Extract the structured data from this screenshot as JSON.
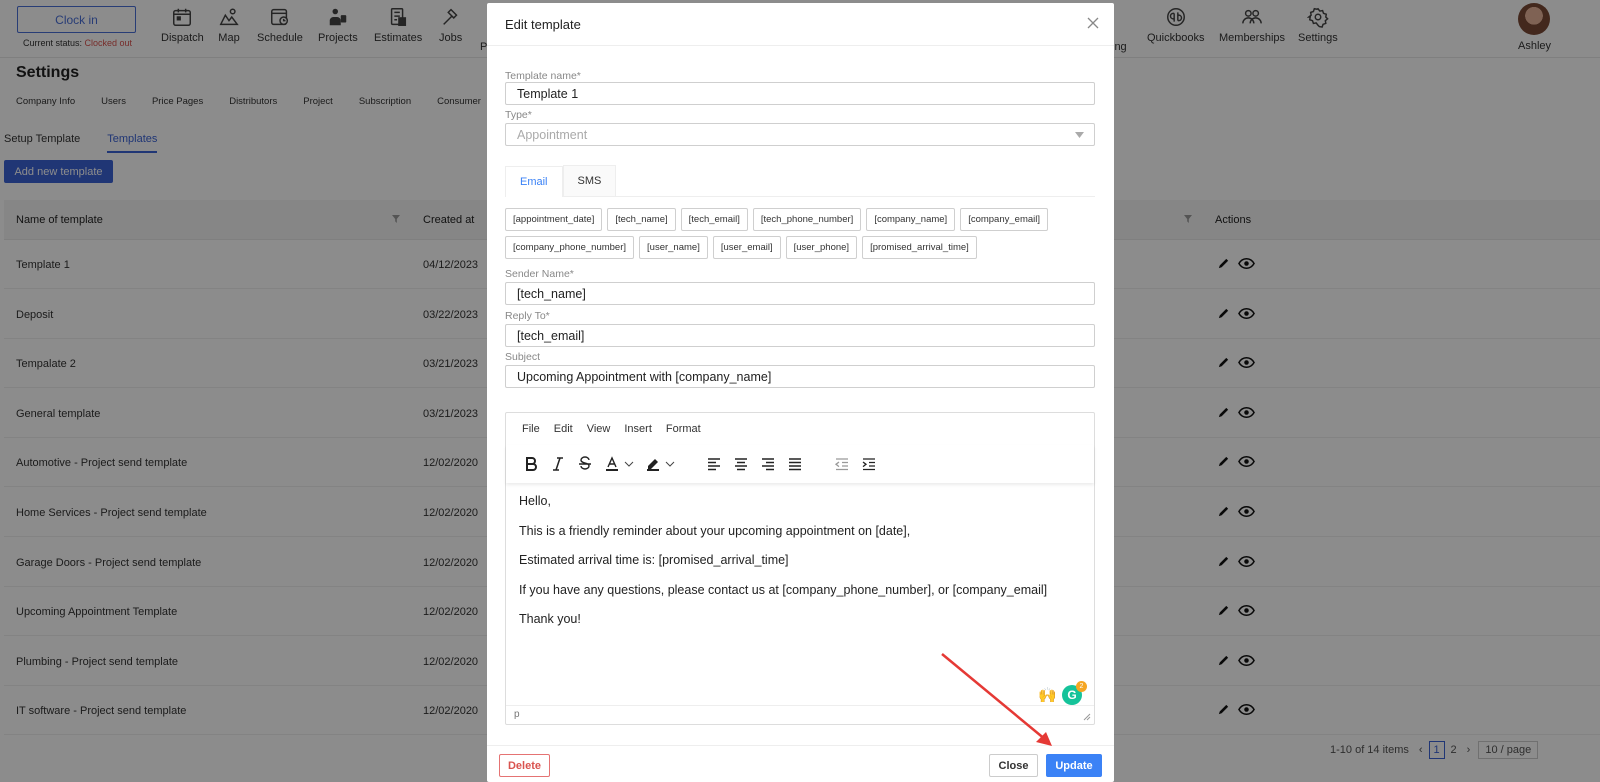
{
  "topbar": {
    "clock_button": "Clock in",
    "status_prefix": "Current status: ",
    "status_value": "Clocked out",
    "nav": [
      {
        "label": "Dispatch",
        "icon": "calendar-icon"
      },
      {
        "label": "Map",
        "icon": "map-icon"
      },
      {
        "label": "Schedule",
        "icon": "schedule-icon"
      },
      {
        "label": "Projects",
        "icon": "projects-icon"
      },
      {
        "label": "Estimates",
        "icon": "estimates-icon"
      },
      {
        "label": "Jobs",
        "icon": "hammer-icon"
      },
      {
        "label": "P",
        "icon": ""
      },
      {
        "label": "ing",
        "icon": ""
      },
      {
        "label": "Quickbooks",
        "icon": "quickbooks-icon"
      },
      {
        "label": "Memberships",
        "icon": "people-icon"
      },
      {
        "label": "Settings",
        "icon": "gear-icon"
      }
    ],
    "user_name": "Ashley"
  },
  "settings": {
    "title": "Settings",
    "tabs": [
      "Company Info",
      "Users",
      "Price Pages",
      "Distributors",
      "Project",
      "Subscription",
      "Consumer"
    ],
    "sub_tabs": [
      "Setup Template",
      "Templates"
    ],
    "add_button": "Add new template"
  },
  "table": {
    "headers": [
      "Name of template",
      "Created at",
      "Actions"
    ],
    "rows": [
      {
        "name": "Template 1",
        "created": "04/12/2023"
      },
      {
        "name": "Deposit",
        "created": "03/22/2023"
      },
      {
        "name": "Tempalate 2",
        "created": "03/21/2023"
      },
      {
        "name": "General template",
        "created": "03/21/2023"
      },
      {
        "name": "Automotive - Project send template",
        "created": "12/02/2020"
      },
      {
        "name": "Home Services - Project send template",
        "created": "12/02/2020"
      },
      {
        "name": "Garage Doors - Project send template",
        "created": "12/02/2020"
      },
      {
        "name": "Upcoming Appointment Template",
        "created": "12/02/2020"
      },
      {
        "name": "Plumbing - Project send template",
        "created": "12/02/2020"
      },
      {
        "name": "IT software - Project send template",
        "created": "12/02/2020"
      }
    ],
    "pagination": {
      "range": "1-10 of 14 items",
      "page1": "1",
      "page2": "2",
      "page_size": "10 / page"
    }
  },
  "modal": {
    "title": "Edit template",
    "template_name_label": "Template name*",
    "template_name_value": "Template 1",
    "type_label": "Type*",
    "type_value": "Appointment",
    "tabs": [
      "Email",
      "SMS"
    ],
    "variables": [
      "[appointment_date]",
      "[tech_name]",
      "[tech_email]",
      "[tech_phone_number]",
      "[company_name]",
      "[company_email]",
      "[company_phone_number]",
      "[user_name]",
      "[user_email]",
      "[user_phone]",
      "[promised_arrival_time]"
    ],
    "sender_label": "Sender Name*",
    "sender_value": "[tech_name]",
    "reply_label": "Reply To*",
    "reply_value": "[tech_email]",
    "subject_label": "Subject",
    "subject_value": "Upcoming Appointment with [company_name]",
    "editor": {
      "menu": [
        "File",
        "Edit",
        "View",
        "Insert",
        "Format"
      ],
      "body": [
        "Hello,",
        "This is a friendly reminder about your upcoming appointment on [date],",
        "Estimated arrival time is: [promised_arrival_time]",
        "If you have any questions, please contact us at [company_phone_number], or [company_email]",
        "Thank you!"
      ],
      "status_path": "p",
      "grammarly_count": "2"
    },
    "buttons": {
      "delete": "Delete",
      "close": "Close",
      "update": "Update"
    }
  },
  "colors": {
    "primary": "#3b82f6",
    "nav_blue": "#3b63d6",
    "danger": "#d9534f",
    "annotation_arrow": "#e53935"
  }
}
